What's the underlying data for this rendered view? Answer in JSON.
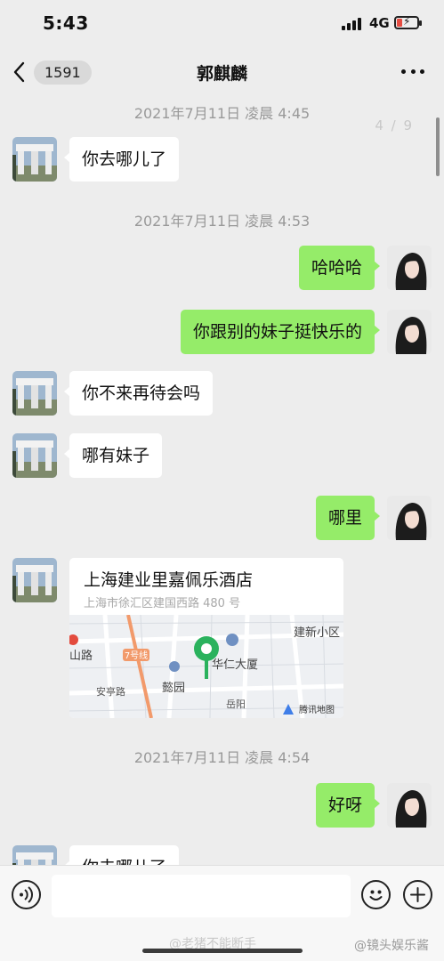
{
  "status_bar": {
    "time": "5:43",
    "network": "4G"
  },
  "nav": {
    "unread_count": "1591",
    "title": "郭麒麟"
  },
  "chat": {
    "page_indicator": "4 / 9",
    "timestamps": [
      "2021年7月11日 凌晨 4:45",
      "2021年7月11日 凌晨 4:53",
      "2021年7月11日 凌晨 4:54"
    ],
    "messages": [
      {
        "side": "in",
        "text": "你去哪儿了"
      },
      {
        "side": "out",
        "text": "哈哈哈"
      },
      {
        "side": "out",
        "text": "你跟别的妹子挺快乐的"
      },
      {
        "side": "in",
        "text": "你不来再待会吗"
      },
      {
        "side": "in",
        "text": "哪有妹子"
      },
      {
        "side": "out",
        "text": "哪里"
      },
      {
        "side": "out",
        "text": "好呀"
      },
      {
        "side": "in",
        "text": "你去哪儿了"
      }
    ],
    "location": {
      "name": "上海建业里嘉佩乐酒店",
      "address": "上海市徐汇区建国西路 480 号",
      "map_labels": [
        "建新小区",
        "山路",
        "7号线",
        "华仁大厦",
        "懿园",
        "安亭路",
        "岳阳",
        "腾讯地图"
      ]
    }
  },
  "watermarks": {
    "center": "@老猪不能断手",
    "right": "@镜头娱乐酱"
  },
  "colors": {
    "background": "#ededed",
    "outgoing_bubble": "#95ec69",
    "incoming_bubble": "#ffffff",
    "pin": "#2ab25d"
  }
}
